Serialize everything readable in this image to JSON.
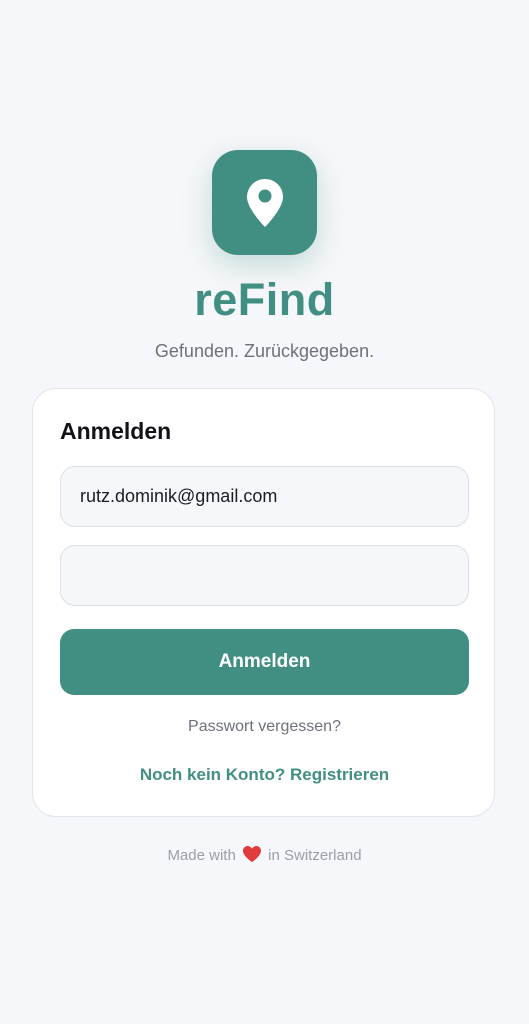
{
  "brand": {
    "name": "reFind",
    "tagline": "Gefunden. Zurückgegeben.",
    "icon": "map-pin-icon",
    "accent_color": "#418f83"
  },
  "login_card": {
    "title": "Anmelden",
    "email": {
      "value": "rutz.dominik@gmail.com",
      "placeholder": ""
    },
    "password": {
      "value": "",
      "placeholder": ""
    },
    "submit_label": "Anmelden",
    "forgot_password_label": "Passwort vergessen?",
    "register_label": "Noch kein Konto? Registrieren"
  },
  "footer": {
    "prefix": "Made with",
    "heart_icon": "heart-icon",
    "heart_color": "#e03a3a",
    "suffix": "in Switzerland"
  }
}
